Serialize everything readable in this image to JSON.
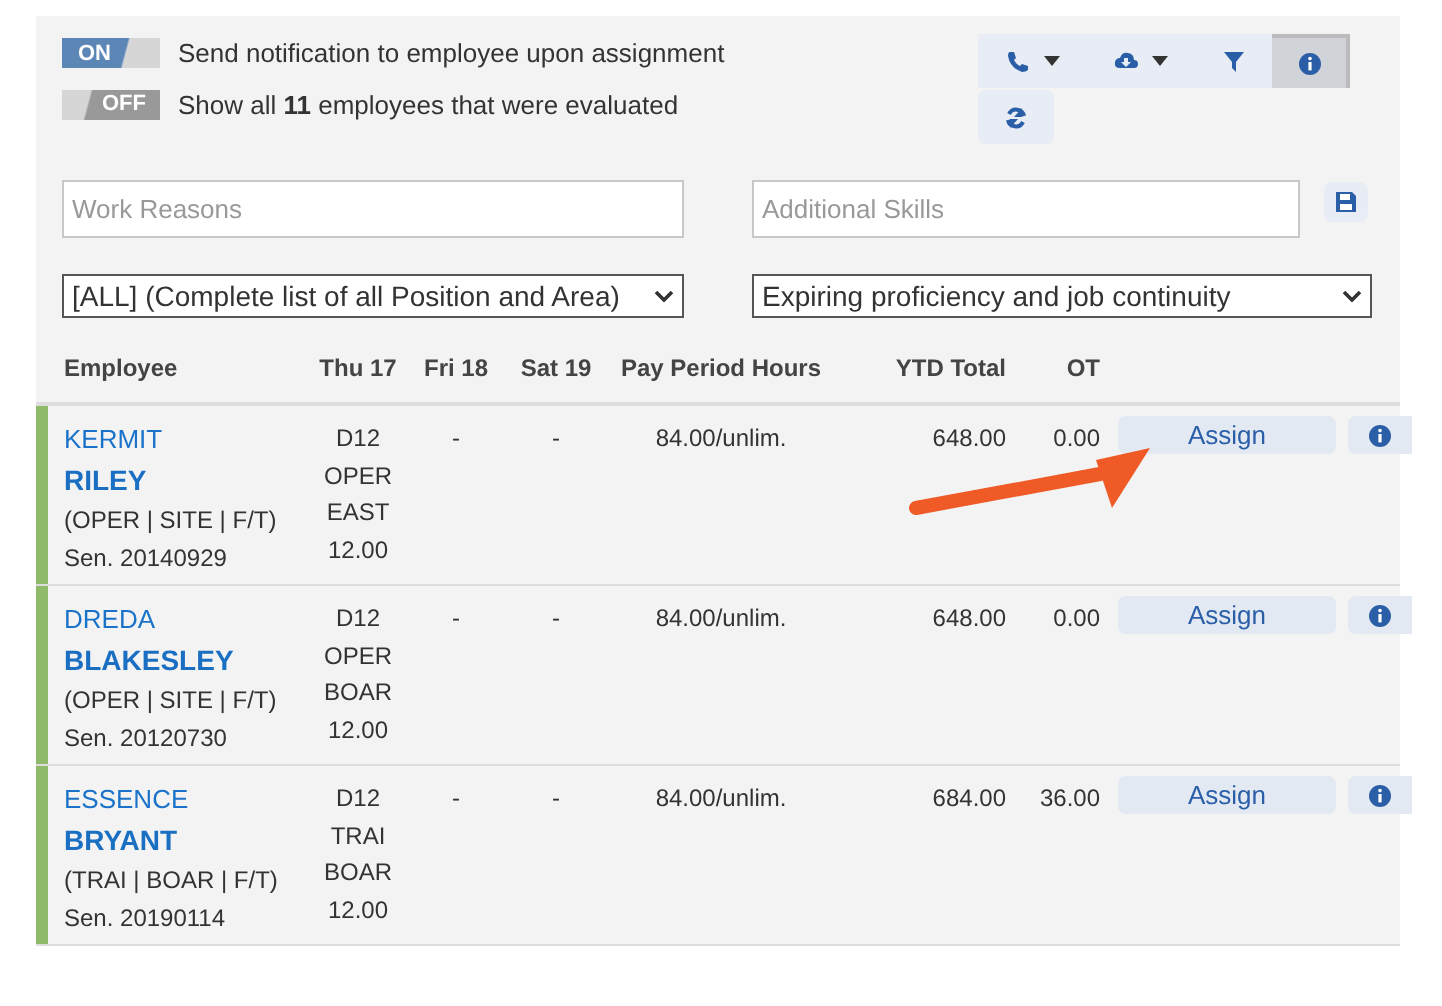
{
  "toggles": [
    {
      "label": "Send notification to employee upon assignment",
      "state_text": "ON",
      "on": true
    },
    {
      "label": "Show all **11** employees that were evaluated",
      "state_text": "OFF",
      "on": false
    }
  ],
  "toolbar": {
    "buttons": [
      {
        "kind": "phone",
        "dropdown": true,
        "selected": false
      },
      {
        "kind": "download",
        "dropdown": true,
        "selected": false
      },
      {
        "kind": "filter",
        "dropdown": false,
        "selected": false
      },
      {
        "kind": "info",
        "dropdown": false,
        "selected": true
      },
      {
        "kind": "refresh",
        "dropdown": false,
        "selected": false
      }
    ]
  },
  "fields": [
    {
      "placeholder": "Work Reasons"
    },
    {
      "placeholder": "Additional Skills"
    }
  ],
  "selects": [
    {
      "value": "[ALL] (Complete list of all Position and Area)"
    },
    {
      "value": "Expiring proficiency and job continuity"
    }
  ],
  "table": {
    "columns": [
      "Employee",
      "Thu 17",
      "Fri 18",
      "Sat 19",
      "Pay Period Hours",
      "YTD Total",
      "OT"
    ],
    "rows": [
      {
        "first": "KERMIT",
        "last": "RILEY",
        "info": "(OPER | SITE | F/T)",
        "seniority": "Sen. 20140929",
        "thu": [
          "D12",
          "OPER",
          "EAST",
          "12.00"
        ],
        "fri": "-",
        "sat": "-",
        "pay": "84.00/unlim.",
        "ytd": "648.00",
        "ot": "0.00",
        "action": "Assign",
        "color": "#8fba6a"
      },
      {
        "first": "DREDA",
        "last": "BLAKESLEY",
        "info": "(OPER | SITE | F/T)",
        "seniority": "Sen. 20120730",
        "thu": [
          "D12",
          "OPER",
          "BOAR",
          "12.00"
        ],
        "fri": "-",
        "sat": "-",
        "pay": "84.00/unlim.",
        "ytd": "648.00",
        "ot": "0.00",
        "action": "Assign",
        "color": "#8fba6a"
      },
      {
        "first": "ESSENCE",
        "last": "BRYANT",
        "info": "(TRAI | BOAR | F/T)",
        "seniority": "Sen. 20190114",
        "thu": [
          "D12",
          "TRAI",
          "BOAR",
          "12.00"
        ],
        "fri": "-",
        "sat": "-",
        "pay": "84.00/unlim.",
        "ytd": "684.00",
        "ot": "36.00",
        "action": "Assign",
        "color": "#8fba6a"
      }
    ]
  }
}
